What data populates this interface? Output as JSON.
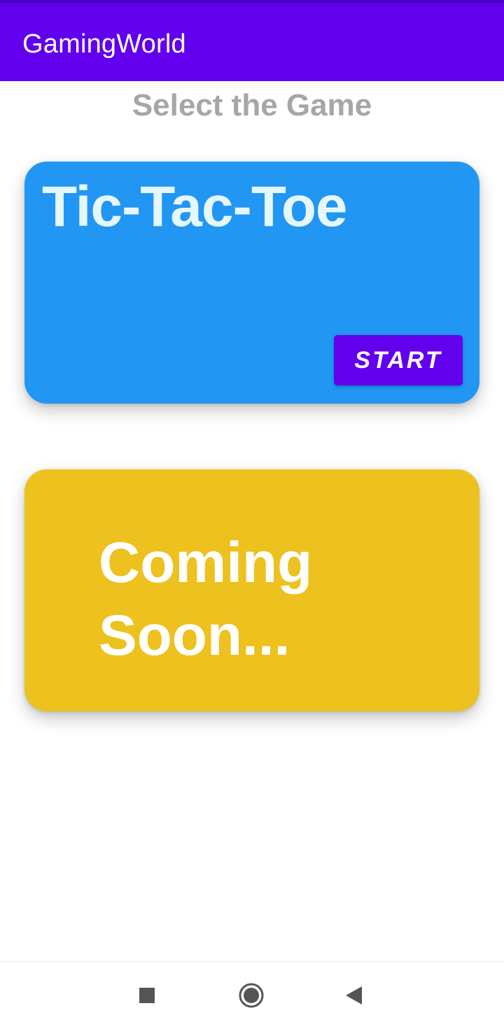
{
  "app_bar": {
    "title": "GamingWorld",
    "color": "#6200EE"
  },
  "page": {
    "title": "Select the Game"
  },
  "cards": {
    "tictactoe": {
      "title": "Tic-Tac-Toe",
      "button_label": "START",
      "color": "#2196F3"
    },
    "coming_soon": {
      "text": "Coming Soon...",
      "color": "#EDC11E"
    }
  },
  "nav_bar": {
    "icons": [
      "recents-square-icon",
      "home-circle-icon",
      "back-triangle-icon"
    ]
  }
}
